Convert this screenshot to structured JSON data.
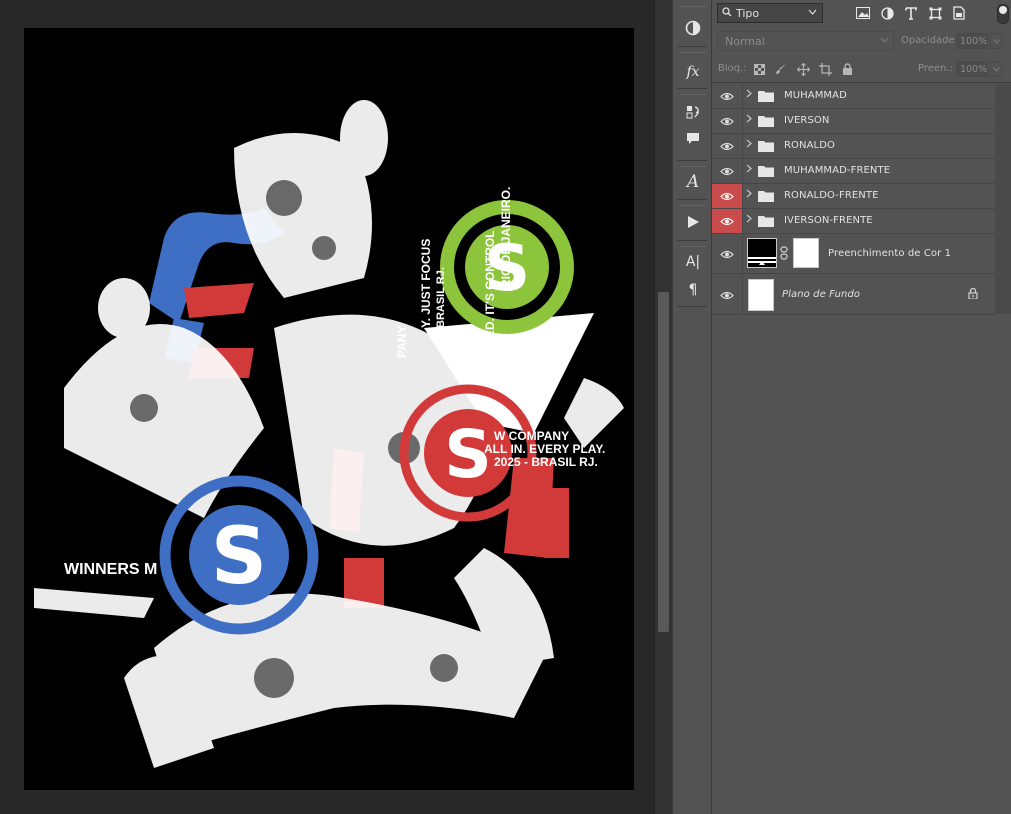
{
  "canvas": {
    "artwork_texts": {
      "winners": "WINNERS M",
      "company_red": "W COMPANY",
      "all_in": "ALL IN. EVERY PLAY.",
      "year_red": "2025 - BRASIL RJ.",
      "just_focus": "Y. JUST FOCUS",
      "company_vertical": "PANY",
      "brasil_rj": "BRASIL RJ.",
      "control": "ED. IT'S CONTROL",
      "rio": "RIO DE JANEIRO.",
      "logo_letter": "S"
    },
    "colors": {
      "blue": "#3e6fc4",
      "red": "#d23a3a",
      "green": "#8cc43c",
      "white": "#ffffff",
      "black": "#000000"
    }
  },
  "tools": [
    "adjust-icon",
    "fx-icon",
    "history-icon",
    "comment-icon",
    "glyph-icon",
    "play-icon",
    "character-icon",
    "paragraph-icon"
  ],
  "tools_text": {
    "fx": "fx",
    "glyph": "A",
    "character": "A|",
    "paragraph": "¶"
  },
  "layers_panel": {
    "filter": {
      "label": "Tipo",
      "icon": "search-icon"
    },
    "blend_mode": "Normal",
    "opacity_label": "Opacidade:",
    "opacity_value": "100%",
    "lock_label": "Bloq.:",
    "fill_label": "Preen.:",
    "fill_value": "100%",
    "layers": [
      {
        "name": "MUHAMMAD",
        "type": "group",
        "highlight": false
      },
      {
        "name": "IVERSON",
        "type": "group",
        "highlight": false
      },
      {
        "name": "RONALDO",
        "type": "group",
        "highlight": false
      },
      {
        "name": "MUHAMMAD-FRENTE",
        "type": "group",
        "highlight": false
      },
      {
        "name": "RONALDO-FRENTE",
        "type": "group",
        "highlight": true
      },
      {
        "name": "IVERSON-FRENTE",
        "type": "group",
        "highlight": true
      },
      {
        "name": "Preenchimento de Cor 1",
        "type": "fill",
        "highlight": false
      },
      {
        "name": "Plano de Fundo",
        "type": "background",
        "highlight": false
      }
    ]
  }
}
